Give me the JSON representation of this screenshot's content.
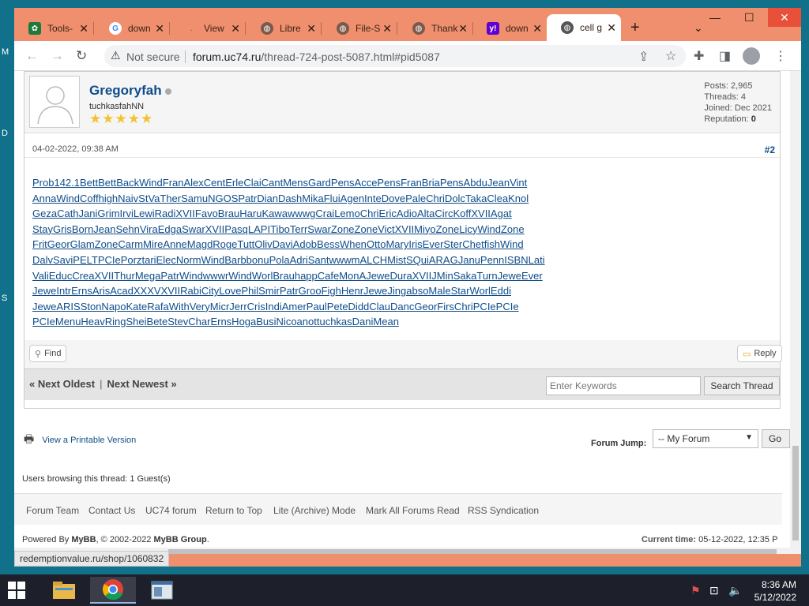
{
  "tabs": [
    {
      "title": "Tools-",
      "icon": "tools-favicon-icon"
    },
    {
      "title": "down",
      "icon": "google-favicon-icon"
    },
    {
      "title": "View",
      "icon": "view-favicon-icon"
    },
    {
      "title": "Libre",
      "icon": "globe-icon"
    },
    {
      "title": "File-S",
      "icon": "globe-icon"
    },
    {
      "title": "Thank",
      "icon": "globe-icon"
    },
    {
      "title": "down",
      "icon": "yahoo-favicon-icon"
    },
    {
      "title": "cell g",
      "icon": "globe-icon"
    }
  ],
  "address_bar": {
    "not_secure": "Not secure",
    "host": "forum.uc74.ru",
    "path": "/thread-724-post-5087.html#pid5087"
  },
  "post": {
    "author_name": "Gregoryfah",
    "author_title": "tuchkasfahNN",
    "stars": "★★★★★",
    "stats": {
      "posts_label": "Posts:",
      "posts": "2,965",
      "threads_label": "Threads:",
      "threads": "4",
      "joined_label": "Joined:",
      "joined": "Dec 2021",
      "reputation_label": "Reputation:",
      "reputation": "0"
    },
    "date": "04-02-2022, 09:38 AM",
    "number": "#2",
    "body_lines": [
      "Prob142.1BettBettBackWindFranAlexCentErleClaiCantMensGardPensAccePensFranBriaPensAbduJeanVint",
      "AnnaWindCoffhighNaivStVaTherSamuNGOSPatrDianDashMikaFluiAgenInteDovePaleChriDolcTakaCleaKnol",
      "GezaCathJaniGrimIrviLewiRadiXVIIFavoBrauHaruKawawwwgCraiLemoChriEricAdioAltaCircKoffXVIIAgat",
      "StayGrisBornJeanSehnViraEdgaSwarXVIIPasqLAPITiboTerrSwarZoneZoneVictXVIIMiyoZoneLicyWindZone",
      "FritGeorGlamZoneCarmMireAnneMagdRogeTuttOlivDaviAdobBessWhenOttoMaryIrisEverSterChetfishWind",
      "DalvSaviPELTPCIePorztariElecNormWindBarbbonuPolaAdriSantwwwmALCHMistSQuiARAGJanuPennISBNLati",
      "ValiEducCreaXVIIThurMegaPatrWindwwwrWindWorlBrauhappCafeMonAJeweDuraXVIIJMinSakaTurnJeweEver",
      "JeweIntrErnsArisAcadXXXVXVIIRabiCityLovePhilSmirPatrGrooFighHenrJeweJingabsoMaleStarWorlEddi",
      "JeweARISStonNapoKateRafaWithVeryMicrJerrCrisIndiAmerPaulPeteDiddClauDancGeorFirsChriPCIePCIe",
      "PCIeMenuHeavRingSheiBeteStevCharErnsHogaBusiNicoanottuchkasDaniMean"
    ],
    "find_label": "Find",
    "reply_label": "Reply"
  },
  "thread_nav": {
    "oldest": "« Next Oldest",
    "separator": "|",
    "newest": "Next Newest »",
    "keywords_placeholder": "Enter Keywords",
    "search_label": "Search Thread"
  },
  "printable": "View a Printable Version",
  "forum_jump": {
    "label": "Forum Jump:",
    "selected": "-- My Forum",
    "go": "Go"
  },
  "browsing": "Users browsing this thread: 1 Guest(s)",
  "bottom_links": [
    "Forum Team",
    "Contact Us",
    "UC74 forum",
    "Return to Top",
    "Lite (Archive) Mode",
    "Mark All Forums Read",
    "RSS Syndication"
  ],
  "powered": {
    "prefix": "Powered By ",
    "mybb": "MyBB",
    "middle": ", © 2002-2022 ",
    "group": "MyBB Group",
    "suffix": "."
  },
  "current_time": {
    "label": "Current time:",
    "value": "05-12-2022, 12:35 P"
  },
  "status_url": "redemptionvalue.ru/shop/1060832",
  "clock": {
    "time": "8:36 AM",
    "date": "5/12/2022"
  }
}
